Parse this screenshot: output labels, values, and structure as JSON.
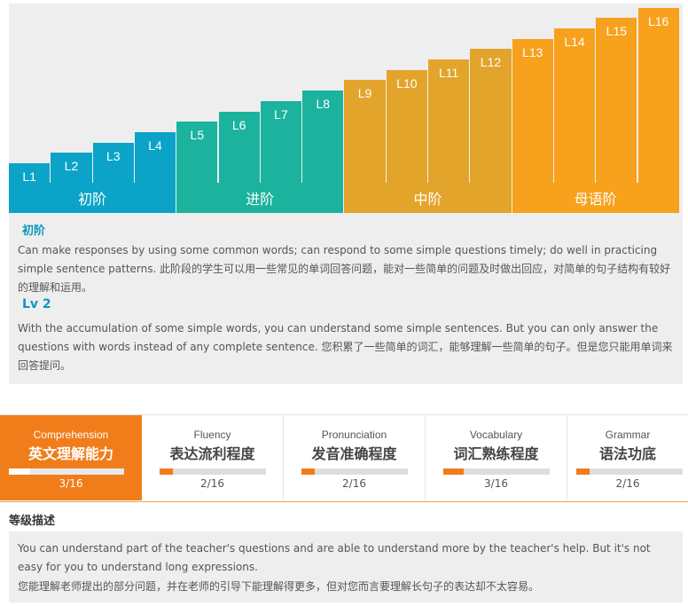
{
  "colors": {
    "beginner": "#0ba3c8",
    "advanced": "#1bb39d",
    "intermediate": "#e3a42b",
    "native": "#f7a11c",
    "active_tab": "#f07d1a",
    "heading_blue": "#0b98bd"
  },
  "levels": [
    "L1",
    "L2",
    "L3",
    "L4",
    "L5",
    "L6",
    "L7",
    "L8",
    "L9",
    "L10",
    "L11",
    "L12",
    "L13",
    "L14",
    "L15",
    "L16"
  ],
  "stages": [
    "初阶",
    "进阶",
    "中阶",
    "母语阶"
  ],
  "description": {
    "stage_name": "初阶",
    "stage_text": "Can make responses by using some common words; can respond to some simple questions timely; do well in practicing simple sentence patterns. 此阶段的学生可以用一些常见的单词回答问题，能对一些简单的问题及时做出回应，对简单的句子结构有较好的理解和运用。",
    "level_name": "Lv 2",
    "level_text": "With the accumulation of some simple words, you can understand some simple sentences. But you can only answer the questions with words instead of any complete sentence. 您积累了一些简单的词汇，能够理解一些简单的句子。但是您只能用单词来回答提问。"
  },
  "tabs": [
    {
      "en": "Comprehension",
      "cn": "英文理解能力",
      "score": "3/16",
      "progress": 0.1875,
      "active": true
    },
    {
      "en": "Fluency",
      "cn": "表达流利程度",
      "score": "2/16",
      "progress": 0.125,
      "active": false
    },
    {
      "en": "Pronunciation",
      "cn": "发音准确程度",
      "score": "2/16",
      "progress": 0.125,
      "active": false
    },
    {
      "en": "Vocabulary",
      "cn": "词汇熟练程度",
      "score": "3/16",
      "progress": 0.1875,
      "active": false
    },
    {
      "en": "Grammar",
      "cn": "语法功底",
      "score": "2/16",
      "progress": 0.125,
      "active": false
    }
  ],
  "level_description": {
    "title": "等级描述",
    "text_en": "You can understand part of the teacher's questions and are able to understand more by the teacher's help. But it's not easy for you to understand long expressions.",
    "text_cn": "您能理解老师提出的部分问题，并在老师的引导下能理解得更多，但对您而言要理解长句子的表达却不太容易。"
  }
}
